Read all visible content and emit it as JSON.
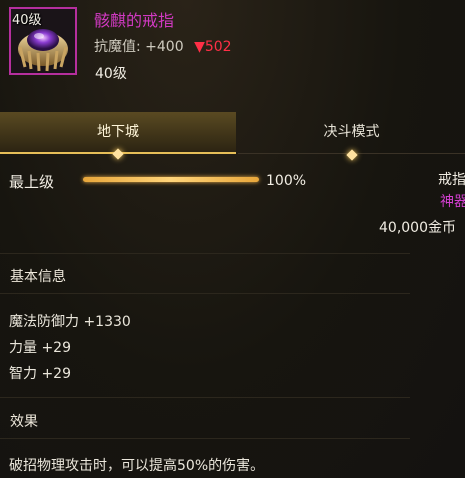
{
  "item": {
    "level_badge": "40级",
    "name": "骸麒的戒指",
    "stat_label": "抗魔值:",
    "stat_value": "+400",
    "stat_change": "▼502",
    "required_level": "40级"
  },
  "tabs": [
    {
      "label": "地下城",
      "active": true
    },
    {
      "label": "决斗模式",
      "active": false
    }
  ],
  "progress": {
    "label": "最上级",
    "percent_text": "100%",
    "fraction": 1.0
  },
  "side_panel": {
    "type": "戒指",
    "rarity": "神器",
    "price": "40,000金币"
  },
  "basic_info": {
    "heading": "基本信息",
    "attributes": [
      "魔法防御力 +1330",
      "力量 +29",
      "智力 +29"
    ]
  },
  "effect": {
    "heading": "效果",
    "text": "破招物理攻击时，可以提高50%的伤害。"
  },
  "colors": {
    "rarity": "#cf39c0",
    "decrease": "#ff2f46",
    "progress": "#ffd47a",
    "active_tab_border": "#e6be58"
  }
}
